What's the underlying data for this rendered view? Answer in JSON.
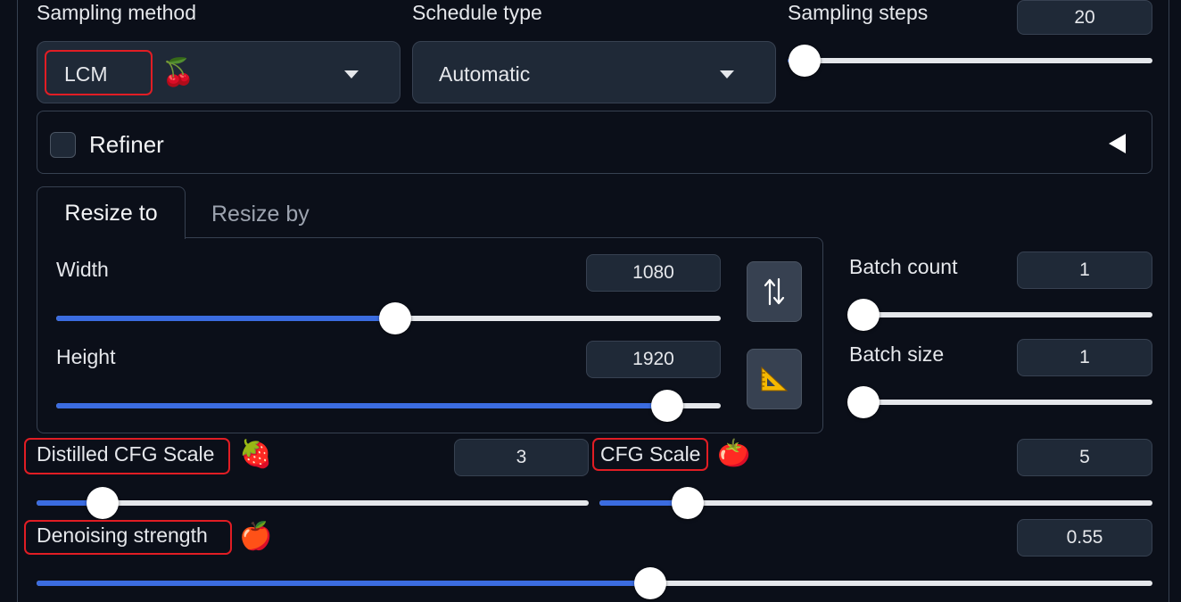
{
  "sampling": {
    "method_label": "Sampling method",
    "method_value": "LCM",
    "method_icon": "cherry-icon",
    "schedule_label": "Schedule type",
    "schedule_value": "Automatic",
    "steps_label": "Sampling steps",
    "steps_value": "20",
    "steps_fraction": 0.046
  },
  "refiner": {
    "label": "Refiner",
    "checked": false
  },
  "resize_tabs": [
    {
      "label": "Resize to",
      "active": true
    },
    {
      "label": "Resize by",
      "active": false
    }
  ],
  "width": {
    "label": "Width",
    "value": "1080",
    "fraction": 0.51
  },
  "height": {
    "label": "Height",
    "value": "1920",
    "fraction": 0.92
  },
  "batch_count": {
    "label": "Batch count",
    "value": "1",
    "fraction": 0.0
  },
  "batch_size": {
    "label": "Batch size",
    "value": "1",
    "fraction": 0.0
  },
  "distilled_cfg": {
    "label": "Distilled CFG Scale",
    "value": "3",
    "fraction": 0.12,
    "icon": "strawberry-icon"
  },
  "cfg": {
    "label": "CFG Scale",
    "value": "5",
    "fraction": 0.16,
    "icon": "tomato-icon"
  },
  "denoising": {
    "label": "Denoising strength",
    "value": "0.55",
    "fraction": 0.55,
    "icon": "apple-icon"
  },
  "colors": {
    "accent": "#3b6ce0",
    "highlight": "#e11d24",
    "background": "#0b0f19"
  }
}
